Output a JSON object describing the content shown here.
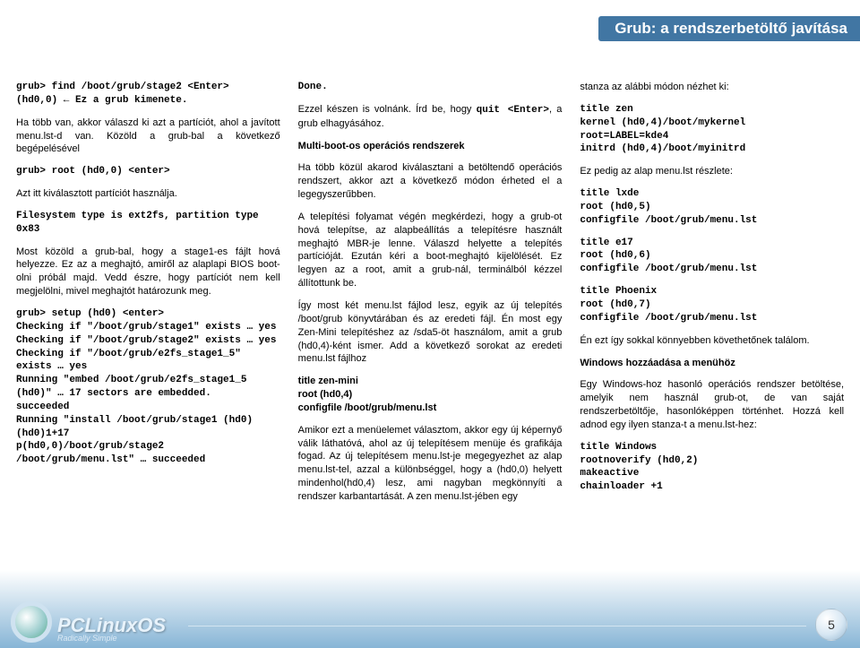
{
  "header": {
    "title": "Grub: a rendszerbetöltő javítása"
  },
  "col1": {
    "code1": "grub> find /boot/grub/stage2 <Enter>\n(hd0,0) ← Ez a grub kimenete.",
    "p1": "Ha több van, akkor válaszd ki azt a partíciót, ahol a javított menu.lst-d van. Közöld a grub-bal a következő begépelésével",
    "code2": "grub> root (hd0,0) <enter>",
    "p2": "Azt itt kiválasztott partíciót használja.",
    "code3": "Filesystem type is ext2fs, partition type 0x83",
    "p3": "Most közöld a grub-bal, hogy a stage1-es fájlt hová helyezze. Ez az a meghajtó, amiről az alaplapi BIOS boot-olni próbál majd. Vedd észre, hogy partíciót nem kell megjelölni, mivel meghajtót határozunk meg.",
    "code4": "grub> setup (hd0) <enter>\nChecking if \"/boot/grub/stage1\" exists … yes\nChecking if \"/boot/grub/stage2\" exists … yes\nChecking if \"/boot/grub/e2fs_stage1_5\" exists … yes\nRunning \"embed /boot/grub/e2fs_stage1_5 (hd0)\" … 17 sectors are embedded.\nsucceeded\nRunning \"install /boot/grub/stage1 (hd0) (hd0)1+17\np(hd0,0)/boot/grub/stage2\n/boot/grub/menu.lst\" … succeeded"
  },
  "col2": {
    "code1": "Done.",
    "p1a": "Ezzel készen is volnánk. Írd be, hogy ",
    "p1b": "quit <Enter>",
    "p1c": ", a grub elhagyásához.",
    "h1": "Multi-boot-os operációs rendszerek",
    "p2": "Ha több közül akarod kiválasztani a betöltendő operációs rendszert, akkor azt a következő módon érheted el a legegyszerűbben.",
    "p3": "A telepítési folyamat végén megkérdezi, hogy a grub-ot hová telepítse, az alapbeállítás a telepítésre használt meghajtó MBR-je lenne. Válaszd helyette a telepítés partícióját. Ezután kéri a boot-meghajtó kijelölését. Ez legyen az a root, amit a grub-nál, terminálból kézzel állítottunk be.",
    "p4": "Így most két menu.lst fájlod lesz, egyik az új telepítés /boot/grub könyvtárában és az eredeti fájl. Én most egy Zen-Mini telepítéshez az /sda5-öt használom, amit a grub (hd0,4)-ként ismer. Add a következő sorokat az eredeti menu.lst fájlhoz",
    "block1": "title zen-mini\nroot (hd0,4)\nconfigfile /boot/grub/menu.lst",
    "p5": "Amikor ezt a menüelemet választom, akkor egy új képernyő válik láthatóvá, ahol az új telepítésem menüje és grafikája fogad. Az új telepítésem menu.lst-je megegyezhet az alap menu.lst-tel, azzal a különbséggel, hogy a (hd0,0) helyett mindenhol(hd0,4) lesz, ami nagyban megkönnyíti a rendszer karbantartását. A zen menu.lst-jében egy"
  },
  "col3": {
    "p1": "stanza az alábbi módon nézhet ki:",
    "code1": "title zen\nkernel (hd0,4)/boot/mykernel\nroot=LABEL=kde4\ninitrd (hd0,4)/boot/myinitrd",
    "p2": "Ez pedig az alap menu.lst részlete:",
    "code2": "title lxde\nroot (hd0,5)\nconfigfile /boot/grub/menu.lst",
    "code3": "title e17\nroot (hd0,6)\nconfigfile /boot/grub/menu.lst",
    "code4": "title Phoenix\nroot (hd0,7)\nconfigfile /boot/grub/menu.lst",
    "p3": "Én ezt így sokkal könnyebben követhetőnek találom.",
    "h1": "Windows hozzáadása a menühöz",
    "p4": "Egy Windows-hoz hasonló operációs rendszer betöltése, amelyik nem használ grub-ot, de van saját rendszerbetöltője, hasonlóképpen történhet. Hozzá kell adnod egy ilyen stanza-t a menu.lst-hez:",
    "code5": "title Windows\nrootnoverify (hd0,2)\nmakeactive\nchainloader +1"
  },
  "footer": {
    "logo_main": "PCLinuxOS",
    "logo_sub": "Radically Simple",
    "page_number": "5"
  }
}
